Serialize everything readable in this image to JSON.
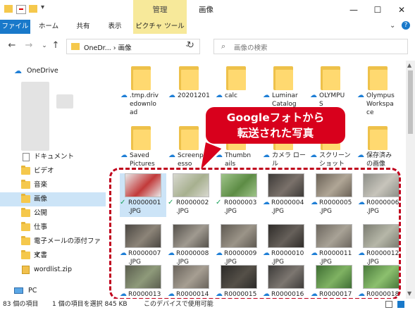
{
  "window": {
    "title": "画像",
    "manage_tab": "管理"
  },
  "ribbon": {
    "tabs": [
      "ファイル",
      "ホーム",
      "共有",
      "表示",
      "ピクチャ ツール"
    ]
  },
  "address": {
    "path": "OneDr...  ›  画像",
    "search_placeholder": "画像の検索"
  },
  "sidebar": {
    "root": "OneDrive",
    "items": [
      "ドキュメント",
      "ビデオ",
      "音楽",
      "画像",
      "公開",
      "仕事",
      "電子メールの添付ファイ",
      "文書",
      "wordlist.zip"
    ],
    "pc": "PC"
  },
  "folders": [
    {
      "name": ".tmp.driv\nedownlo\nad"
    },
    {
      "name": "20201201"
    },
    {
      "name": "calc"
    },
    {
      "name": "Luminar\nCatalog"
    },
    {
      "name": "OLYMPU\nS"
    },
    {
      "name": "Olympus\nWorkspa\nce"
    },
    {
      "name": "Saved\nPictures"
    },
    {
      "name": "Screenpr\nesso"
    },
    {
      "name": "Thumbn\nails"
    },
    {
      "name": "カメラ ロー\nル"
    },
    {
      "name": "スクリーン\nショット"
    },
    {
      "name": "保存済み\nの画像"
    }
  ],
  "photos": [
    {
      "name": "R0000001\n.JPG",
      "status": "check"
    },
    {
      "name": "R0000002\n.JPG",
      "status": "check"
    },
    {
      "name": "R0000003\n.JPG",
      "status": "check"
    },
    {
      "name": "R0000004\n.JPG",
      "status": "cloud"
    },
    {
      "name": "R0000005\n.JPG",
      "status": "cloud"
    },
    {
      "name": "R0000006\n.JPG",
      "status": "cloud"
    },
    {
      "name": "R0000007\n.JPG",
      "status": "cloud"
    },
    {
      "name": "R0000008\n.JPG",
      "status": "cloud"
    },
    {
      "name": "R0000009\n.JPG",
      "status": "cloud"
    },
    {
      "name": "R0000010\n.JPG",
      "status": "cloud"
    },
    {
      "name": "R0000011\n.JPG",
      "status": "cloud"
    },
    {
      "name": "R0000012\n.JPG",
      "status": "cloud"
    },
    {
      "name": "R0000013",
      "status": "cloud"
    },
    {
      "name": "R0000014",
      "status": "cloud"
    },
    {
      "name": "R0000015",
      "status": "cloud"
    },
    {
      "name": "R0000016",
      "status": "cloud"
    },
    {
      "name": "R0000017",
      "status": "cloud"
    },
    {
      "name": "R0000018",
      "status": "cloud"
    }
  ],
  "callout": {
    "line1": "Googleフォトから",
    "line2": "転送された写真"
  },
  "status": {
    "count": "83 個の項目",
    "selection": "1 個の項目を選択  845 KB",
    "availability": "このデバイスで使用可能"
  },
  "colors": {
    "accent": "#1979ca",
    "manage": "#f7e99a",
    "callout": "#d8001c",
    "folder": "#ffd970"
  }
}
